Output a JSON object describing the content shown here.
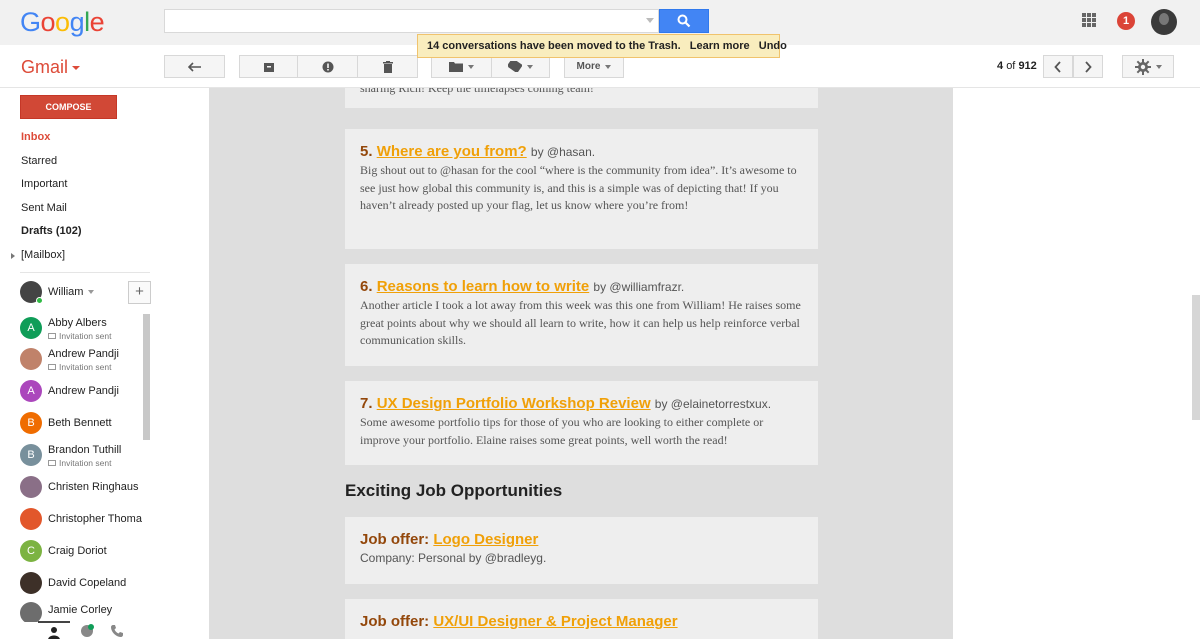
{
  "header": {
    "logo": [
      "G",
      "o",
      "o",
      "g",
      "l",
      "e"
    ],
    "logo_colors": [
      "#4285f4",
      "#ea4335",
      "#fbbc05",
      "#4285f4",
      "#34a853",
      "#ea4335"
    ],
    "notification_count": "1"
  },
  "toolbar": {
    "app_label": "Gmail",
    "more_label": "More",
    "pager_position": "4",
    "pager_of": "of",
    "pager_total": "912"
  },
  "toast": {
    "message": "14 conversations have been moved to the Trash.",
    "learn_more": "Learn more",
    "undo": "Undo"
  },
  "sidebar": {
    "compose": "COMPOSE",
    "items": [
      "Inbox",
      "Starred",
      "Important",
      "Sent Mail",
      "Drafts (102)",
      "[Mailbox]"
    ],
    "user": "William",
    "contacts": [
      {
        "name": "Abby Albers",
        "sub": "Invitation sent",
        "initial": "A",
        "color": "#0f9d58"
      },
      {
        "name": "Andrew Pandji",
        "sub": "Invitation sent",
        "initial": "",
        "color": "#c0826a"
      },
      {
        "name": "Andrew Pandji",
        "sub": "",
        "initial": "A",
        "color": "#ab47bc"
      },
      {
        "name": "Beth Bennett",
        "sub": "",
        "initial": "B",
        "color": "#ef6c00"
      },
      {
        "name": "Brandon Tuthill",
        "sub": "Invitation sent",
        "initial": "B",
        "color": "#78909c"
      },
      {
        "name": "Christen Ringhaus",
        "sub": "",
        "initial": "",
        "color": "#8a6f87"
      },
      {
        "name": "Christopher Thoma",
        "sub": "",
        "initial": "",
        "color": "#e2572b"
      },
      {
        "name": "Craig Doriot",
        "sub": "",
        "initial": "C",
        "color": "#7cb342"
      },
      {
        "name": "David Copeland",
        "sub": "",
        "initial": "",
        "color": "#3d3028"
      },
      {
        "name": "Jamie Corley",
        "sub": "",
        "initial": "",
        "color": "#6d6d6d"
      }
    ]
  },
  "email": {
    "top_fragment": "sharing Rich! Keep the timelapses coming team!",
    "items": [
      {
        "num": "5.",
        "title": "Where are you from?",
        "by": "by @hasan.",
        "body": "Big shout out to @hasan for the cool “where is the community from idea”. It’s awesome to see just how global this community is, and this is a simple was of depicting that! If you haven’t already posted up your flag, let us know where you’re from!"
      },
      {
        "num": "6.",
        "title": "Reasons to learn how to write",
        "by": "by @williamfrazr.",
        "body": "Another article I took a lot away from this week was this one from William! He raises some great points about why we should all learn to write, how it can help us help reinforce verbal communication skills."
      },
      {
        "num": "7.",
        "title": "UX Design Portfolio Workshop Review",
        "by": "by @elainetorrestxux.",
        "body": "Some awesome portfolio tips for those of you who are looking to either complete or improve your portfolio. Elaine raises some great points, well worth the read!"
      }
    ],
    "section_heading": "Exciting Job Opportunities",
    "jobs": [
      {
        "prefix": "Job offer:",
        "title": "Logo Designer",
        "company": "Company: Personal by @bradleyg."
      },
      {
        "prefix": "Job offer:",
        "title": "UX/UI Designer & Project Manager",
        "company": ""
      }
    ]
  }
}
